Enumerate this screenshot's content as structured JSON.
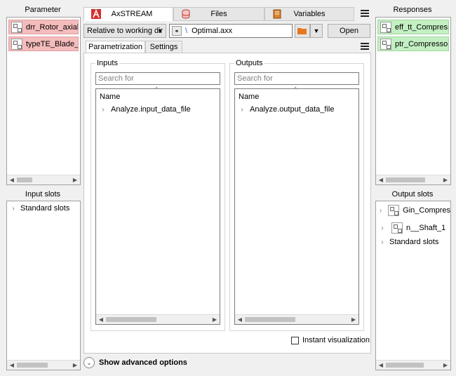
{
  "left": {
    "parameter_title": "Parameter",
    "parameters": [
      "drr_Rotor_axial_u",
      "typeTE_Blade_Ro"
    ],
    "input_slots_title": "Input slots",
    "input_slots": [
      "Standard slots"
    ]
  },
  "right": {
    "responses_title": "Responses",
    "responses": [
      "eff_tt_Compresso",
      "ptr_Compressor_"
    ],
    "output_slots_title": "Output slots",
    "output_slots": [
      "Gin_Compres",
      "n__Shaft_1",
      "Standard slots"
    ]
  },
  "tabs": {
    "axstream": "AxSTREAM",
    "files": "Files",
    "variables": "Variables"
  },
  "toolbar": {
    "path_mode": "Relative to working dir",
    "path_prefix": "\\",
    "file_name": "Optimal.axx",
    "open_label": "Open"
  },
  "subtabs": {
    "parametrization": "Parametrization",
    "settings": "Settings"
  },
  "inputs": {
    "title": "Inputs",
    "search_placeholder": "Search for",
    "column_header": "Name",
    "items": [
      "Analyze.input_data_file"
    ]
  },
  "outputs": {
    "title": "Outputs",
    "search_placeholder": "Search for",
    "column_header": "Name",
    "items": [
      "Analyze.output_data_file"
    ]
  },
  "options": {
    "instant_visualization": "Instant visualization",
    "instant_visualization_checked": false,
    "show_advanced": "Show advanced options"
  },
  "colors": {
    "parameter_bg": "#f4bcbc",
    "response_bg": "#c3f0c3",
    "axstream_logo": "#d32f2f"
  }
}
